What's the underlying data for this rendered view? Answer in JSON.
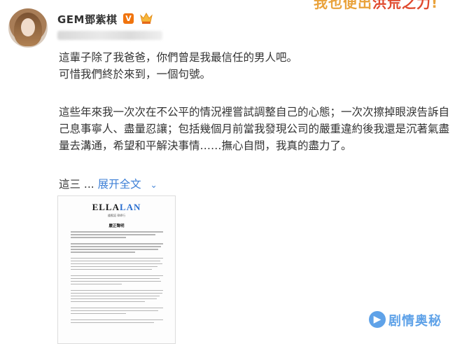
{
  "post": {
    "username": "GEM鄧紫棋",
    "verified_badge": "V",
    "paragraph_1": "這輩子除了我爸爸，你們曾是我最信任的男人吧。",
    "paragraph_2": "可惜我們終於來到，一個句號。",
    "paragraph_3": "這些年來我一次次在不公平的情況裡嘗試調整自己的心態；一次次擦掉眼淚告訴自己息事寧人、盡量忍讓；包括幾個月前當我發現公司的嚴重違約後我還是沉著氣盡量去溝通，希望和平解決事情……撫心自問，我真的盡力了。",
    "truncated_text": "這三 ...",
    "expand_label": "展开全文"
  },
  "banner": {
    "text_main": "我也便出",
    "text_highlight": "洪荒之力",
    "text_end": "!"
  },
  "document": {
    "logo_dark": "ELLA",
    "logo_blue": "LAN",
    "subtitle": "鍾應諾 律師行",
    "title": "嚴正聲明"
  },
  "watermark": {
    "text": "剧情奥秘"
  },
  "colors": {
    "link": "#3d7fd6",
    "vbadge": "#f0740e",
    "watermark": "#5fa2e8"
  }
}
